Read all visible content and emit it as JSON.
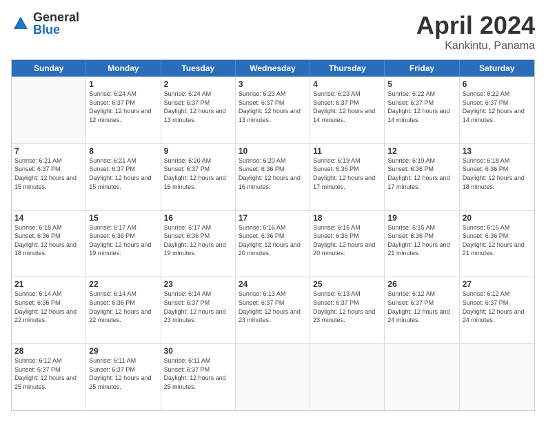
{
  "logo": {
    "general": "General",
    "blue": "Blue"
  },
  "title": "April 2024",
  "subtitle": "Kankintu, Panama",
  "header_days": [
    "Sunday",
    "Monday",
    "Tuesday",
    "Wednesday",
    "Thursday",
    "Friday",
    "Saturday"
  ],
  "weeks": [
    [
      {
        "day": "",
        "empty": true
      },
      {
        "day": "1",
        "sunrise": "6:24 AM",
        "sunset": "6:37 PM",
        "daylight": "12 hours and 12 minutes."
      },
      {
        "day": "2",
        "sunrise": "6:24 AM",
        "sunset": "6:37 PM",
        "daylight": "12 hours and 13 minutes."
      },
      {
        "day": "3",
        "sunrise": "6:23 AM",
        "sunset": "6:37 PM",
        "daylight": "12 hours and 13 minutes."
      },
      {
        "day": "4",
        "sunrise": "6:23 AM",
        "sunset": "6:37 PM",
        "daylight": "12 hours and 14 minutes."
      },
      {
        "day": "5",
        "sunrise": "6:22 AM",
        "sunset": "6:37 PM",
        "daylight": "12 hours and 14 minutes."
      },
      {
        "day": "6",
        "sunrise": "6:22 AM",
        "sunset": "6:37 PM",
        "daylight": "12 hours and 14 minutes."
      }
    ],
    [
      {
        "day": "7",
        "sunrise": "6:21 AM",
        "sunset": "6:37 PM",
        "daylight": "12 hours and 15 minutes."
      },
      {
        "day": "8",
        "sunrise": "6:21 AM",
        "sunset": "6:37 PM",
        "daylight": "12 hours and 15 minutes."
      },
      {
        "day": "9",
        "sunrise": "6:20 AM",
        "sunset": "6:37 PM",
        "daylight": "12 hours and 16 minutes."
      },
      {
        "day": "10",
        "sunrise": "6:20 AM",
        "sunset": "6:36 PM",
        "daylight": "12 hours and 16 minutes."
      },
      {
        "day": "11",
        "sunrise": "6:19 AM",
        "sunset": "6:36 PM",
        "daylight": "12 hours and 17 minutes."
      },
      {
        "day": "12",
        "sunrise": "6:19 AM",
        "sunset": "6:36 PM",
        "daylight": "12 hours and 17 minutes."
      },
      {
        "day": "13",
        "sunrise": "6:18 AM",
        "sunset": "6:36 PM",
        "daylight": "12 hours and 18 minutes."
      }
    ],
    [
      {
        "day": "14",
        "sunrise": "6:18 AM",
        "sunset": "6:36 PM",
        "daylight": "12 hours and 18 minutes."
      },
      {
        "day": "15",
        "sunrise": "6:17 AM",
        "sunset": "6:36 PM",
        "daylight": "12 hours and 19 minutes."
      },
      {
        "day": "16",
        "sunrise": "6:17 AM",
        "sunset": "6:36 PM",
        "daylight": "12 hours and 19 minutes."
      },
      {
        "day": "17",
        "sunrise": "6:16 AM",
        "sunset": "6:36 PM",
        "daylight": "12 hours and 20 minutes."
      },
      {
        "day": "18",
        "sunrise": "6:16 AM",
        "sunset": "6:36 PM",
        "daylight": "12 hours and 20 minutes."
      },
      {
        "day": "19",
        "sunrise": "6:15 AM",
        "sunset": "6:36 PM",
        "daylight": "12 hours and 21 minutes."
      },
      {
        "day": "20",
        "sunrise": "6:15 AM",
        "sunset": "6:36 PM",
        "daylight": "12 hours and 21 minutes."
      }
    ],
    [
      {
        "day": "21",
        "sunrise": "6:14 AM",
        "sunset": "6:36 PM",
        "daylight": "12 hours and 22 minutes."
      },
      {
        "day": "22",
        "sunrise": "6:14 AM",
        "sunset": "6:36 PM",
        "daylight": "12 hours and 22 minutes."
      },
      {
        "day": "23",
        "sunrise": "6:14 AM",
        "sunset": "6:37 PM",
        "daylight": "12 hours and 23 minutes."
      },
      {
        "day": "24",
        "sunrise": "6:13 AM",
        "sunset": "6:37 PM",
        "daylight": "12 hours and 23 minutes."
      },
      {
        "day": "25",
        "sunrise": "6:13 AM",
        "sunset": "6:37 PM",
        "daylight": "12 hours and 23 minutes."
      },
      {
        "day": "26",
        "sunrise": "6:12 AM",
        "sunset": "6:37 PM",
        "daylight": "12 hours and 24 minutes."
      },
      {
        "day": "27",
        "sunrise": "6:12 AM",
        "sunset": "6:37 PM",
        "daylight": "12 hours and 24 minutes."
      }
    ],
    [
      {
        "day": "28",
        "sunrise": "6:12 AM",
        "sunset": "6:37 PM",
        "daylight": "12 hours and 25 minutes."
      },
      {
        "day": "29",
        "sunrise": "6:11 AM",
        "sunset": "6:37 PM",
        "daylight": "12 hours and 25 minutes."
      },
      {
        "day": "30",
        "sunrise": "6:11 AM",
        "sunset": "6:37 PM",
        "daylight": "12 hours and 25 minutes."
      },
      {
        "day": "",
        "empty": true
      },
      {
        "day": "",
        "empty": true
      },
      {
        "day": "",
        "empty": true
      },
      {
        "day": "",
        "empty": true
      }
    ]
  ]
}
